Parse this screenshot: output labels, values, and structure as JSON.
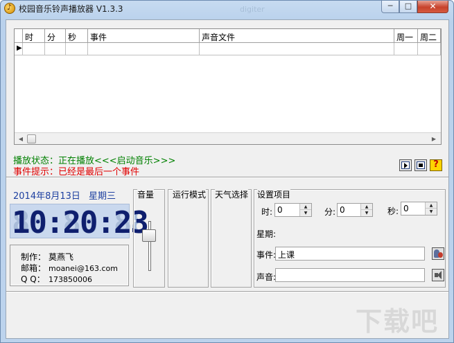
{
  "window": {
    "title": "校园音乐铃声播放器 V1.3.3",
    "ghost_title": "digiter",
    "min_glyph": "─",
    "max_glyph": "□",
    "close_glyph": "✕"
  },
  "grid": {
    "columns": [
      "时",
      "分",
      "秒",
      "事件",
      "声音文件",
      "周一",
      "周二"
    ],
    "row_indicator": "▶",
    "scroll_left": "◀",
    "scroll_right": "▶"
  },
  "status": {
    "playing": "播放状态：正在播放<<<启动音乐>>>",
    "event_hint": "事件提示：已经是最后一个事件",
    "playing_color": "#008000",
    "hint_color": "#e00000"
  },
  "controls": {
    "help": "?"
  },
  "clock": {
    "date": "2014年8月13日",
    "weekday": "星期三",
    "ghost": "88:88:88",
    "time": "10:20:23"
  },
  "credits": {
    "author_label": "制作：",
    "author": "莫燕飞",
    "email_label": "邮箱：",
    "email": "moanei@163.com",
    "qq_label": "Q Q：",
    "qq": "173850006"
  },
  "panels": {
    "volume": "音量",
    "volume_level": 0.78,
    "run_mode": "运行模式",
    "weather": "天气选择",
    "settings": "设置项目"
  },
  "settings": {
    "hour_label": "时:",
    "hour_value": "0",
    "minute_label": "分:",
    "minute_value": "0",
    "second_label": "秒:",
    "second_value": "0",
    "weekday_label": "星期:",
    "event_label": "事件:",
    "event_value": "上课",
    "sound_label": "声音:",
    "sound_value": "",
    "spin_up": "▲",
    "spin_down": "▼"
  },
  "watermark": "下载吧"
}
